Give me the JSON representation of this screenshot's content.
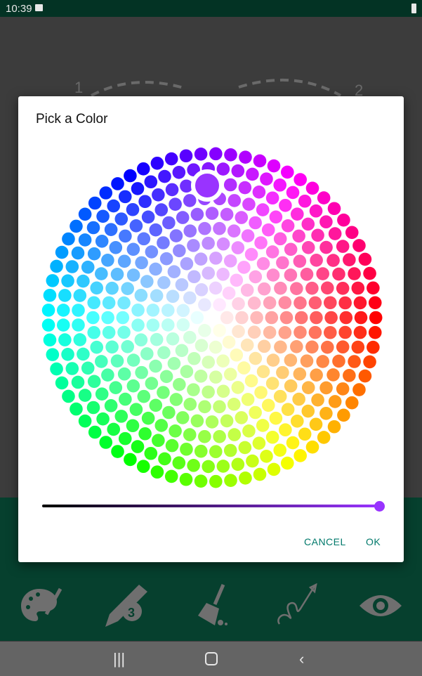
{
  "status_bar": {
    "time": "10:39",
    "icons": [
      "image-icon",
      "battery-icon"
    ]
  },
  "background": {
    "step_labels": [
      "1",
      "2"
    ]
  },
  "dialog": {
    "title": "Pick a Color",
    "selected_color": "#9933ff",
    "brightness": 1.0,
    "cancel_label": "CANCEL",
    "ok_label": "OK"
  },
  "toolbar": {
    "tools": [
      "palette-icon",
      "pencil-size-icon",
      "broom-icon",
      "path-arrow-icon",
      "eye-icon"
    ],
    "pencil_size": "3"
  },
  "nav_bar": {
    "buttons": [
      "recents",
      "home",
      "back"
    ]
  }
}
